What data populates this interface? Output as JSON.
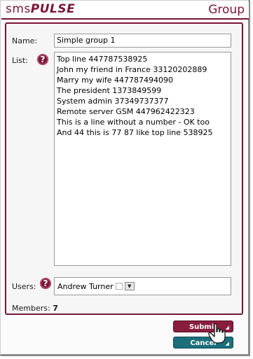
{
  "header": {
    "logo_sms": "sms",
    "logo_pulse": "PULSE",
    "title": "Group"
  },
  "form": {
    "name_label": "Name:",
    "name_value": "Simple group 1",
    "list_label": "List:",
    "list_lines": [
      "Top line 447787538925",
      "John my friend in France 33120202889",
      "Marry my wife 447787494090",
      "The president 1373849599",
      "System admin 37349737377",
      "Remote server GSM 447962422323",
      "This is a line without a number - OK too",
      "And 44 this is 77 87 like top line 538925"
    ],
    "users_label": "Users:",
    "users_selected": "Andrew Turner",
    "members_label": "Members:",
    "members_count": "7",
    "help_glyph": "?"
  },
  "buttons": {
    "submit_label": "Submit",
    "cancel_label": "Cancel"
  },
  "colors": {
    "brand": "#7b1535",
    "submit": "#8a1d3e",
    "cancel": "#1a6f7a"
  },
  "icons": {
    "help": "help-icon",
    "cursor": "hand-pointer-icon",
    "dropdown": "chevron-down-icon"
  }
}
